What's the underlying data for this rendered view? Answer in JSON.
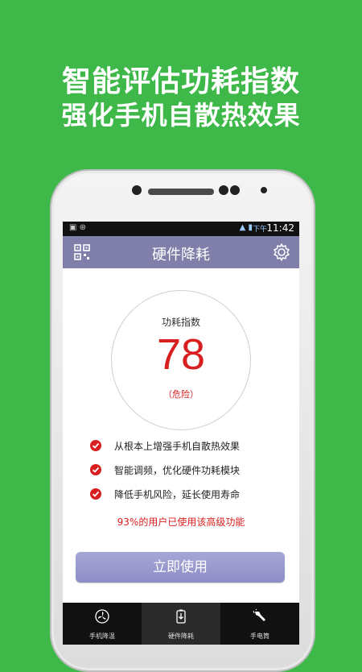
{
  "promo": {
    "line1": "智能评估功耗指数",
    "line2": "强化手机自散热效果"
  },
  "statusbar": {
    "time": "11:42",
    "ampm": "下午"
  },
  "app": {
    "title": "硬件降耗"
  },
  "gauge": {
    "label": "功耗指数",
    "value": "78",
    "status": "（危险）"
  },
  "features": [
    "从根本上增强手机自散热效果",
    "智能调频，优化硬件功耗模块",
    "降低手机风险，延长使用寿命"
  ],
  "users_text": "93%的用户已使用该高级功能",
  "action_button": "立即使用",
  "tabs": [
    {
      "label": "手机降温",
      "icon": "fan-icon",
      "selected": false
    },
    {
      "label": "硬件降耗",
      "icon": "battery-icon",
      "selected": true
    },
    {
      "label": "手电筒",
      "icon": "flashlight-icon",
      "selected": false
    }
  ],
  "colors": {
    "background": "#3fb84a",
    "titlebar": "#7f7faa",
    "danger": "#d81e1e",
    "button": "#9a9acf"
  }
}
